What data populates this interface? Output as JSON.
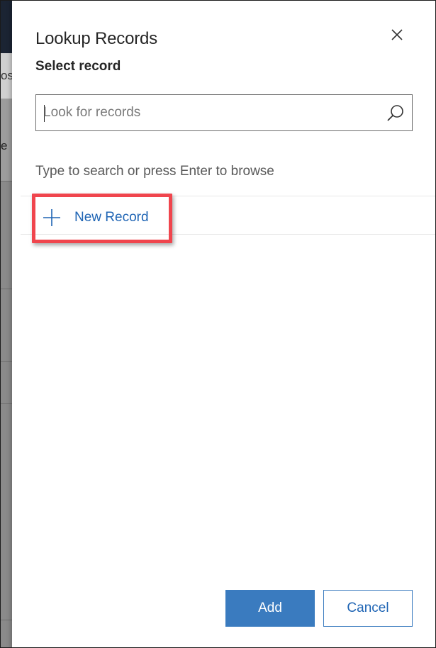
{
  "background": {
    "partial_text_1": "os",
    "partial_text_2": "e"
  },
  "dialog": {
    "title": "Lookup Records",
    "subtitle": "Select record",
    "search": {
      "placeholder": "Look for records",
      "value": "",
      "icon": "search-icon"
    },
    "hint": "Type to search or press Enter to browse",
    "new_record": {
      "label": "New Record",
      "icon": "plus-icon",
      "highlight_color": "#f0454d"
    },
    "buttons": {
      "add_label": "Add",
      "cancel_label": "Cancel"
    },
    "close_icon": "close-icon"
  },
  "colors": {
    "accent": "#3a7bbf",
    "link": "#1e64b4"
  }
}
